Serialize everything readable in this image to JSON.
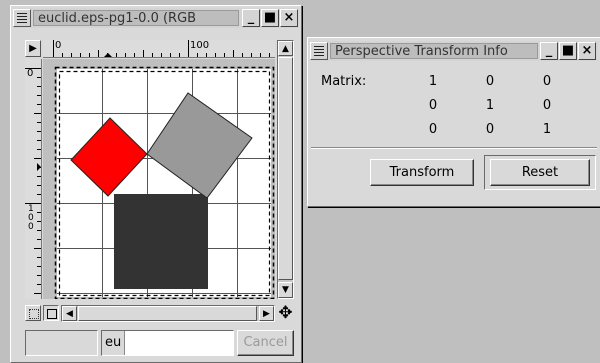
{
  "image_window": {
    "title": "euclid.eps-pg1-0.0 (RGB",
    "ruler_h_labels": [
      "0",
      "100"
    ],
    "ruler_v_labels": [
      "0",
      "1\n0\n0"
    ],
    "status_left": "",
    "status_input_value": "eu",
    "cancel_label": "Cancel"
  },
  "transform_dialog": {
    "title": "Perspective Transform Info",
    "matrix_label": "Matrix:",
    "matrix": [
      [
        "1",
        "0",
        "0"
      ],
      [
        "0",
        "1",
        "0"
      ],
      [
        "0",
        "0",
        "1"
      ]
    ],
    "transform_label": "Transform",
    "reset_label": "Reset"
  },
  "colors": {
    "desktop": "#bfbfbf",
    "red_square": "#ff0000",
    "gray_square": "#999999",
    "dark_square": "#333333"
  }
}
